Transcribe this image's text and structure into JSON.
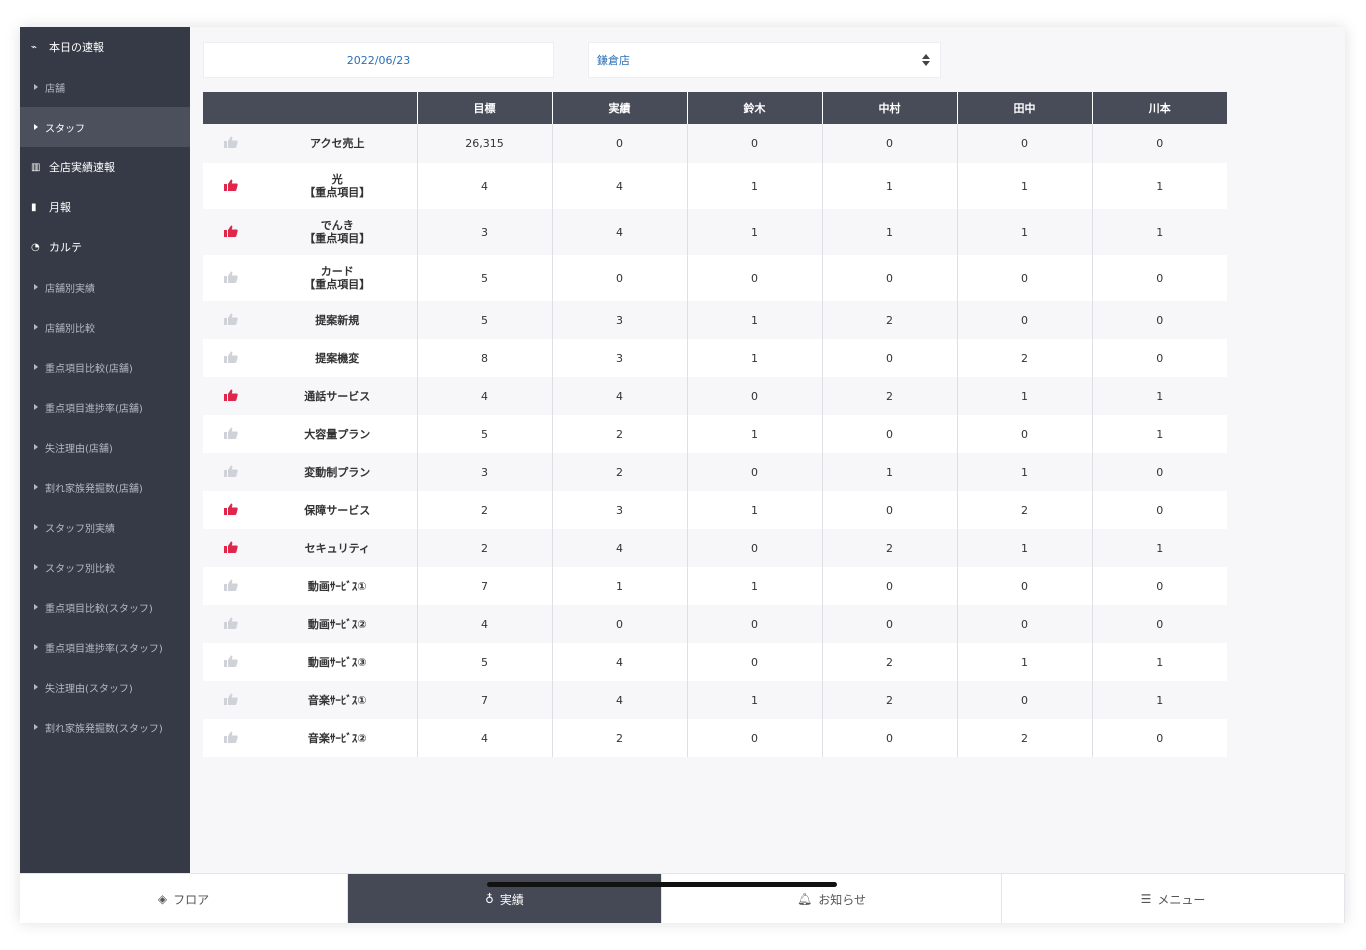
{
  "sidebar": {
    "items": [
      {
        "label": "本日の速報",
        "kind": "section",
        "icon": "line-chart-icon",
        "glyph": "⌁"
      },
      {
        "label": "店舗",
        "kind": "sub"
      },
      {
        "label": "スタッフ",
        "kind": "sub-active"
      },
      {
        "label": "全店実績速報",
        "kind": "section",
        "icon": "bar-chart-icon",
        "glyph": "▥"
      },
      {
        "label": "月報",
        "kind": "section",
        "icon": "file-icon",
        "glyph": "▮"
      },
      {
        "label": "カルテ",
        "kind": "section",
        "icon": "pie-chart-icon",
        "glyph": "◔"
      },
      {
        "label": "店舗別実績",
        "kind": "sub"
      },
      {
        "label": "店舗別比較",
        "kind": "sub"
      },
      {
        "label": "重点項目比較(店舗)",
        "kind": "sub"
      },
      {
        "label": "重点項目進捗率(店舗)",
        "kind": "sub"
      },
      {
        "label": "失注理由(店舗)",
        "kind": "sub"
      },
      {
        "label": "割れ家族発掘数(店舗)",
        "kind": "sub"
      },
      {
        "label": "スタッフ別実績",
        "kind": "sub"
      },
      {
        "label": "スタッフ別比較",
        "kind": "sub"
      },
      {
        "label": "重点項目比較(スタッフ)",
        "kind": "sub"
      },
      {
        "label": "重点項目進捗率(スタッフ)",
        "kind": "sub"
      },
      {
        "label": "失注理由(スタッフ)",
        "kind": "sub"
      },
      {
        "label": "割れ家族発掘数(スタッフ)",
        "kind": "sub"
      }
    ]
  },
  "filters": {
    "date": "2022/06/23",
    "store": "鎌倉店"
  },
  "table": {
    "headers": [
      "",
      "目標",
      "実績",
      "鈴木",
      "中村",
      "田中",
      "川本"
    ],
    "rows": [
      {
        "liked": false,
        "name": [
          "アクセ売上"
        ],
        "values": [
          "26,315",
          "0",
          "0",
          "0",
          "0",
          "0"
        ]
      },
      {
        "liked": true,
        "name": [
          "光",
          "【重点項目】"
        ],
        "values": [
          "4",
          "4",
          "1",
          "1",
          "1",
          "1"
        ]
      },
      {
        "liked": true,
        "name": [
          "でんき",
          "【重点項目】"
        ],
        "values": [
          "3",
          "4",
          "1",
          "1",
          "1",
          "1"
        ]
      },
      {
        "liked": false,
        "name": [
          "カード",
          "【重点項目】"
        ],
        "values": [
          "5",
          "0",
          "0",
          "0",
          "0",
          "0"
        ]
      },
      {
        "liked": false,
        "name": [
          "提案新規"
        ],
        "values": [
          "5",
          "3",
          "1",
          "2",
          "0",
          "0"
        ]
      },
      {
        "liked": false,
        "name": [
          "提案機変"
        ],
        "values": [
          "8",
          "3",
          "1",
          "0",
          "2",
          "0"
        ]
      },
      {
        "liked": true,
        "name": [
          "通話サービス"
        ],
        "values": [
          "4",
          "4",
          "0",
          "2",
          "1",
          "1"
        ]
      },
      {
        "liked": false,
        "name": [
          "大容量プラン"
        ],
        "values": [
          "5",
          "2",
          "1",
          "0",
          "0",
          "1"
        ]
      },
      {
        "liked": false,
        "name": [
          "変動制プラン"
        ],
        "values": [
          "3",
          "2",
          "0",
          "1",
          "1",
          "0"
        ]
      },
      {
        "liked": true,
        "name": [
          "保障サービス"
        ],
        "values": [
          "2",
          "3",
          "1",
          "0",
          "2",
          "0"
        ]
      },
      {
        "liked": true,
        "name": [
          "セキュリティ"
        ],
        "values": [
          "2",
          "4",
          "0",
          "2",
          "1",
          "1"
        ]
      },
      {
        "liked": false,
        "name": [
          "動画ｻｰﾋﾞｽ①"
        ],
        "values": [
          "7",
          "1",
          "1",
          "0",
          "0",
          "0"
        ]
      },
      {
        "liked": false,
        "name": [
          "動画ｻｰﾋﾞｽ②"
        ],
        "values": [
          "4",
          "0",
          "0",
          "0",
          "0",
          "0"
        ]
      },
      {
        "liked": false,
        "name": [
          "動画ｻｰﾋﾞｽ③"
        ],
        "values": [
          "5",
          "4",
          "0",
          "2",
          "1",
          "1"
        ]
      },
      {
        "liked": false,
        "name": [
          "音楽ｻｰﾋﾞｽ①"
        ],
        "values": [
          "7",
          "4",
          "1",
          "2",
          "0",
          "1"
        ]
      },
      {
        "liked": false,
        "name": [
          "音楽ｻｰﾋﾞｽ②"
        ],
        "values": [
          "4",
          "2",
          "0",
          "0",
          "2",
          "0"
        ]
      }
    ]
  },
  "bottom_nav": {
    "tabs": [
      {
        "label": "フロア",
        "icon": "layers-icon",
        "glyph": "◈",
        "active": false
      },
      {
        "label": "実績",
        "icon": "award-icon",
        "glyph": "♁",
        "active": true
      },
      {
        "label": "お知らせ",
        "icon": "bell-icon",
        "glyph": "🔔︎",
        "active": false
      },
      {
        "label": "メニュー",
        "icon": "list-icon",
        "glyph": "☰",
        "active": false
      }
    ]
  },
  "colors": {
    "sidebar_bg": "#363a46",
    "header_bg": "#484c58",
    "liked": "#e0264a",
    "unliked": "#cfd2d8",
    "link": "#2c6fb7"
  }
}
